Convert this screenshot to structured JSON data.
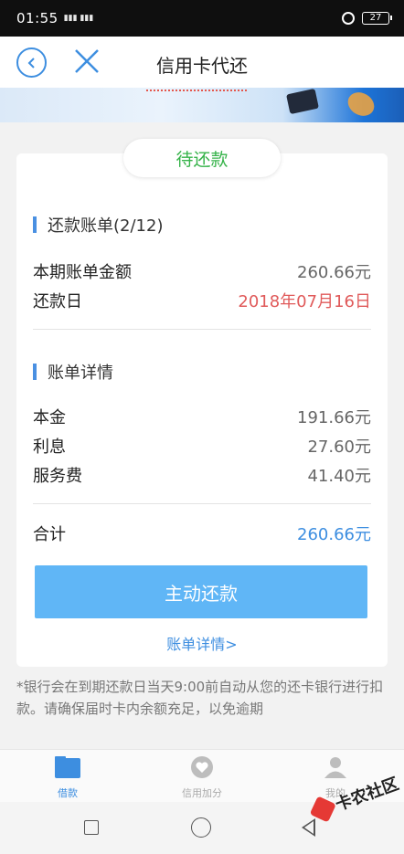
{
  "status_bar": {
    "time": "01:55",
    "signal_text": "ᵗˢⁱˡ ⁴ᴳ",
    "battery": "27"
  },
  "nav": {
    "title": "信用卡代还"
  },
  "bill": {
    "status": "待还款",
    "section_title": "还款账单(2/12)",
    "amount_label": "本期账单金额",
    "amount_value": "260.66元",
    "due_label": "还款日",
    "due_value": "2018年07月16日"
  },
  "details": {
    "section_title": "账单详情",
    "principal_label": "本金",
    "principal_value": "191.66元",
    "interest_label": "利息",
    "interest_value": "27.60元",
    "fee_label": "服务费",
    "fee_value": "41.40元",
    "total_label": "合计",
    "total_value": "260.66元"
  },
  "actions": {
    "repay_button": "主动还款",
    "detail_link": "账单详情>"
  },
  "footnote": "*银行会在到期还款日当天9:00前自动从您的还卡银行进行扣款。请确保届时卡内余额充足，以免逾期",
  "tabs": [
    {
      "label": "借款",
      "icon": "folder-icon",
      "active": true
    },
    {
      "label": "信用加分",
      "icon": "heart-icon",
      "active": false
    },
    {
      "label": "我的",
      "icon": "user-icon",
      "active": false
    }
  ],
  "watermark": "卡农社区",
  "colors": {
    "primary_blue": "#3d8ee0",
    "button_blue": "#60b6f6",
    "status_green": "#36b34a",
    "due_red": "#e05a5a"
  }
}
